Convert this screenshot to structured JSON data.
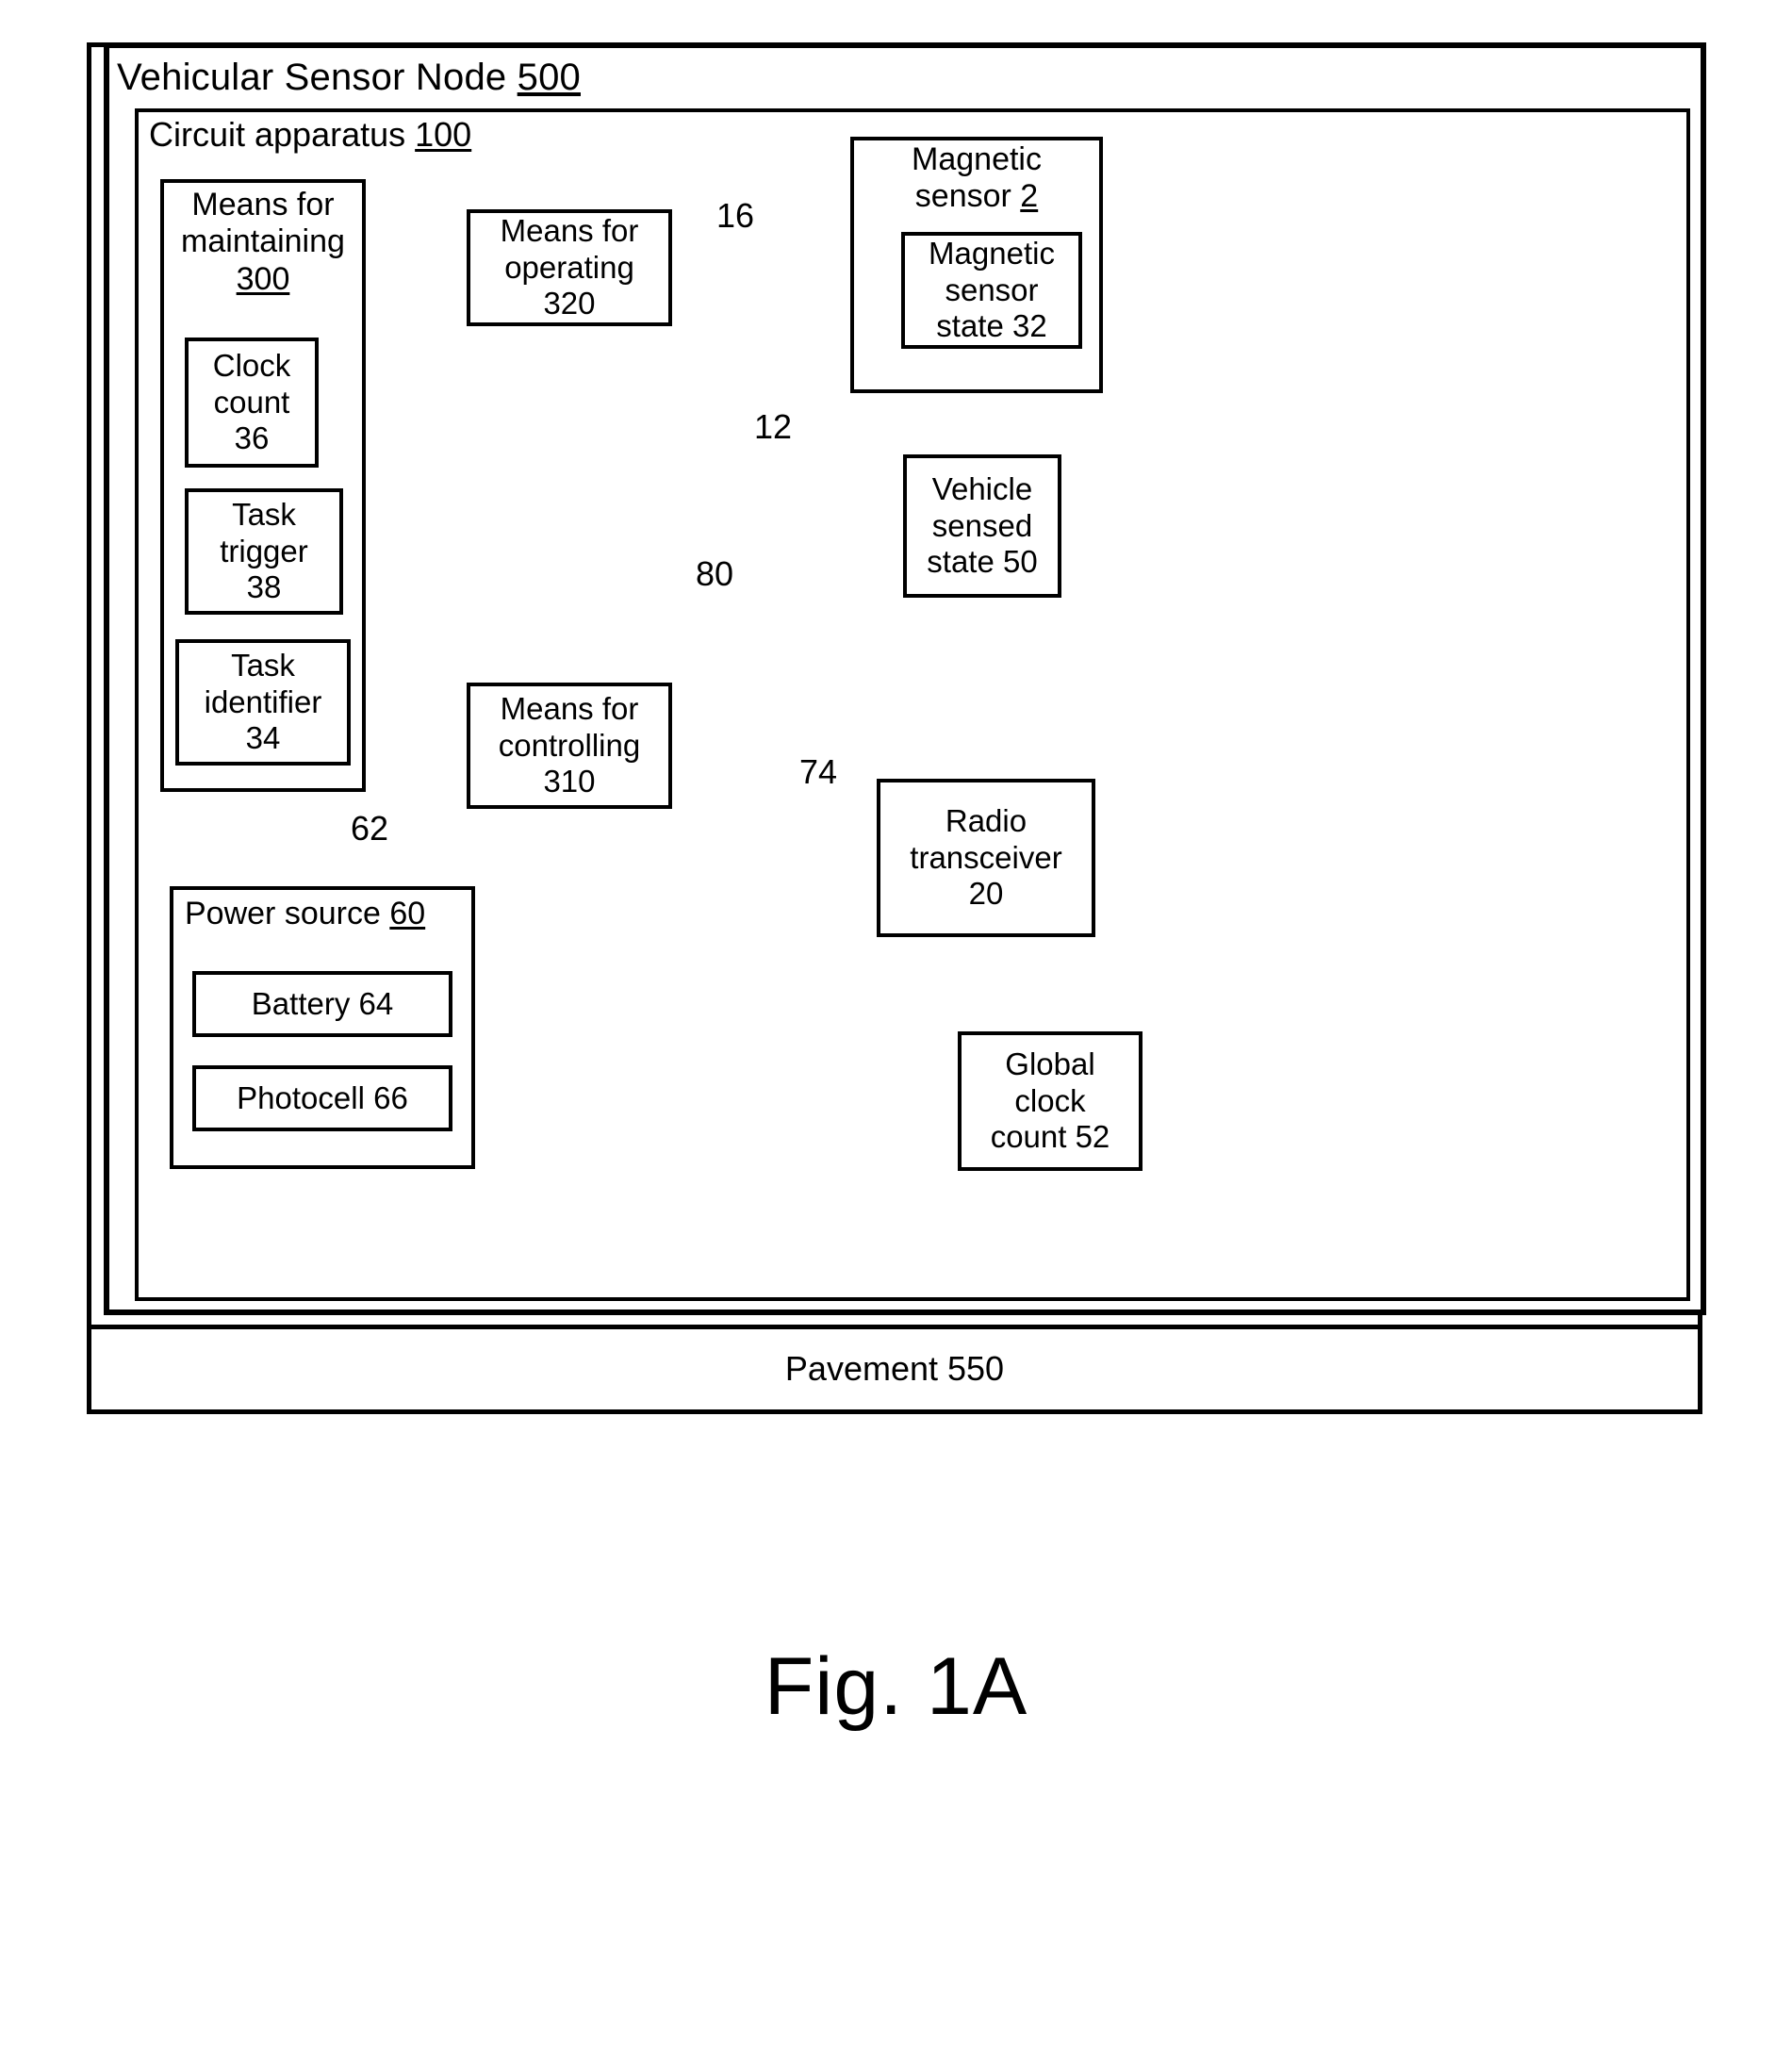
{
  "figure": {
    "caption": "Fig. 1A",
    "outer_label": "Vehicular Sensor Node 500",
    "outer_label_text": "Vehicular Sensor Node ",
    "outer_label_num": "500",
    "circuit_label_text": "Circuit apparatus ",
    "circuit_label_num": "100",
    "pavement": "Pavement 550"
  },
  "blocks": {
    "means_maintaining": {
      "line1": "Means for",
      "line2": "maintaining",
      "num": "300"
    },
    "clock_count": {
      "line1": "Clock",
      "line2": "count",
      "line3": "36"
    },
    "task_trigger": {
      "line1": "Task",
      "line2": "trigger",
      "line3": "38"
    },
    "task_identifier": {
      "line1": "Task",
      "line2": "identifier",
      "line3": "34"
    },
    "means_operating": {
      "line1": "Means for",
      "line2": "operating",
      "line3": "320"
    },
    "means_controlling": {
      "line1": "Means for",
      "line2": "controlling",
      "line3": "310"
    },
    "magnetic_sensor": {
      "line1": "Magnetic",
      "line2": "sensor ",
      "num": "2"
    },
    "magnetic_sensor_state": {
      "line1": "Magnetic",
      "line2": "sensor",
      "line3": "state 32"
    },
    "vehicle_sensed_state": {
      "line1": "Vehicle",
      "line2": "sensed",
      "line3": "state 50"
    },
    "radio_transceiver": {
      "line1": "Radio",
      "line2": "transceiver",
      "line3": "20"
    },
    "global_clock_count": {
      "line1": "Global",
      "line2": "clock",
      "line3": "count 52"
    },
    "power_source": {
      "label_text": "Power source ",
      "num": "60"
    },
    "battery": {
      "label": "Battery 64"
    },
    "photocell": {
      "label": "Photocell 66"
    }
  },
  "reference_numerals": {
    "n16": "16",
    "n12": "12",
    "n80": "80",
    "n74": "74",
    "n62": "62"
  },
  "colors": {
    "ink": "#000000",
    "paper": "#ffffff"
  }
}
